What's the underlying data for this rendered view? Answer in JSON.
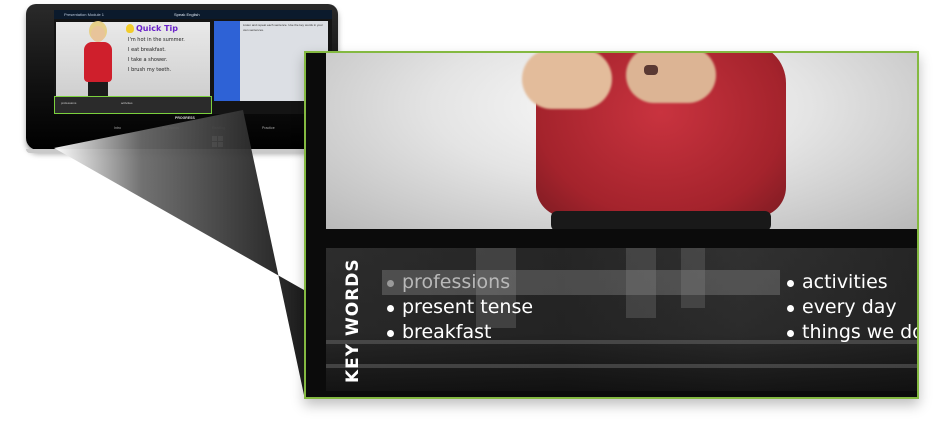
{
  "tablet": {
    "top_bar": {
      "app_title": "Presentation Module 1",
      "brand": "Speak English"
    },
    "quick_tip": {
      "title": "Quick Tip",
      "lines": [
        "I'm hot in the summer.",
        "I eat breakfast.",
        "I take a shower.",
        "I brush my teeth."
      ]
    },
    "side_panel_text": "Listen and repeat each sentence. Use the key words in your own sentences.",
    "toolbar": {
      "label": "PROGRESS",
      "items": [
        "Intro",
        "Key Words",
        "Reading",
        "Practice"
      ]
    }
  },
  "zoom": {
    "keywords_title": "KEY WORDS",
    "left_items": [
      {
        "label": "professions",
        "active": true
      },
      {
        "label": "present tense",
        "active": false
      },
      {
        "label": "breakfast",
        "active": false
      }
    ],
    "right_items": [
      {
        "label": "activities"
      },
      {
        "label": "every day"
      },
      {
        "label": "things we do"
      }
    ]
  },
  "colors": {
    "highlight_border": "#84b941",
    "shirt_red": "#a4232c",
    "tip_purple": "#6a22c9",
    "panel_blue": "#2e62d6"
  }
}
